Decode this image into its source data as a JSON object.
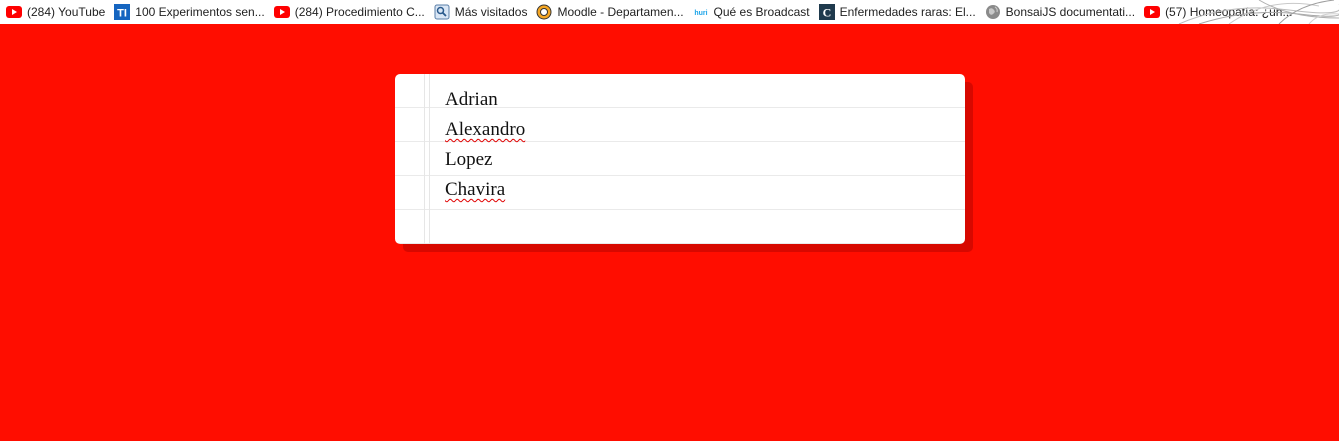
{
  "bookmarks_bar": {
    "items": [
      {
        "label": "(284) YouTube",
        "icon": "youtube-icon"
      },
      {
        "label": "100 Experimentos sen...",
        "icon": "ti-icon"
      },
      {
        "label": "(284) Procedimiento C...",
        "icon": "youtube-icon"
      },
      {
        "label": "Más visitados",
        "icon": "most-visited-icon"
      },
      {
        "label": "Moodle - Departamen...",
        "icon": "moodle-icon"
      },
      {
        "label": "Qué es Broadcast",
        "icon": "huri-icon"
      },
      {
        "label": "Enfermedades raras: El...",
        "icon": "c-icon"
      },
      {
        "label": "BonsaiJS documentati...",
        "icon": "globe-icon"
      },
      {
        "label": "(57) Homeopatía: ¿un...",
        "icon": "youtube-icon"
      }
    ],
    "favicon_texts": {
      "ti": "TI",
      "huri": "huri",
      "c": "C"
    }
  },
  "notepad": {
    "lines": [
      {
        "text": "Adrian",
        "misspelled": false
      },
      {
        "text": "Alexandro",
        "misspelled": true
      },
      {
        "text": "Lopez",
        "misspelled": false
      },
      {
        "text": "Chavira",
        "misspelled": true
      }
    ]
  },
  "colors": {
    "page_background": "#ff0d00",
    "card_background": "#ffffff",
    "youtube_red": "#ff0000",
    "ti_blue": "#1565c0",
    "c_icon_dark": "#1f3a4d",
    "huri_blue": "#1aa3e8"
  }
}
